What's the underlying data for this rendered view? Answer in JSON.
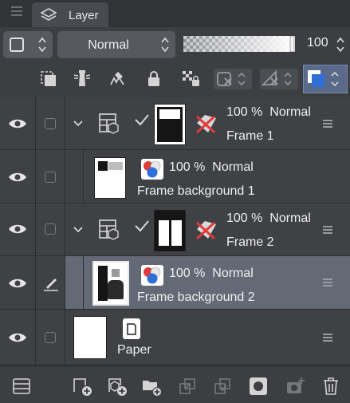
{
  "panel": {
    "tab_label": "Layer"
  },
  "toolbar": {
    "blend_mode": "Normal",
    "opacity_value": "100"
  },
  "layers": [
    {
      "kind": "folder",
      "opacity_text": "100 %",
      "blend": "Normal",
      "name": "Frame 1"
    },
    {
      "kind": "raster",
      "opacity_text": "100 %",
      "blend": "Normal",
      "name": "Frame background 1"
    },
    {
      "kind": "folder",
      "opacity_text": "100 %",
      "blend": "Normal",
      "name": "Frame 2"
    },
    {
      "kind": "raster",
      "opacity_text": "100 %",
      "blend": "Normal",
      "name": "Frame background 2",
      "selected": true
    },
    {
      "kind": "paper",
      "name": "Paper"
    }
  ],
  "icons": {
    "toolbar2": [
      "clip-to-layer-below-icon",
      "reference-layer-icon",
      "draft-layer-icon",
      "lock-layer-icon",
      "lock-transparent-pixels-icon",
      "mask-settings-icon",
      "ruler-settings-icon",
      "layer-color-icon"
    ],
    "bottom": [
      "layer-property-icon",
      "new-raster-layer-icon",
      "new-vector-layer-icon",
      "new-folder-icon",
      "transfer-to-lower-layer-icon",
      "combine-with-layer-below-icon",
      "create-layer-mask-icon",
      "apply-mask-icon",
      "delete-layer-icon"
    ]
  },
  "colors": {
    "accent_selected_row": "#636975",
    "layer_color_blue": "#2e6fd8",
    "mask_red": "#e03a3a"
  }
}
